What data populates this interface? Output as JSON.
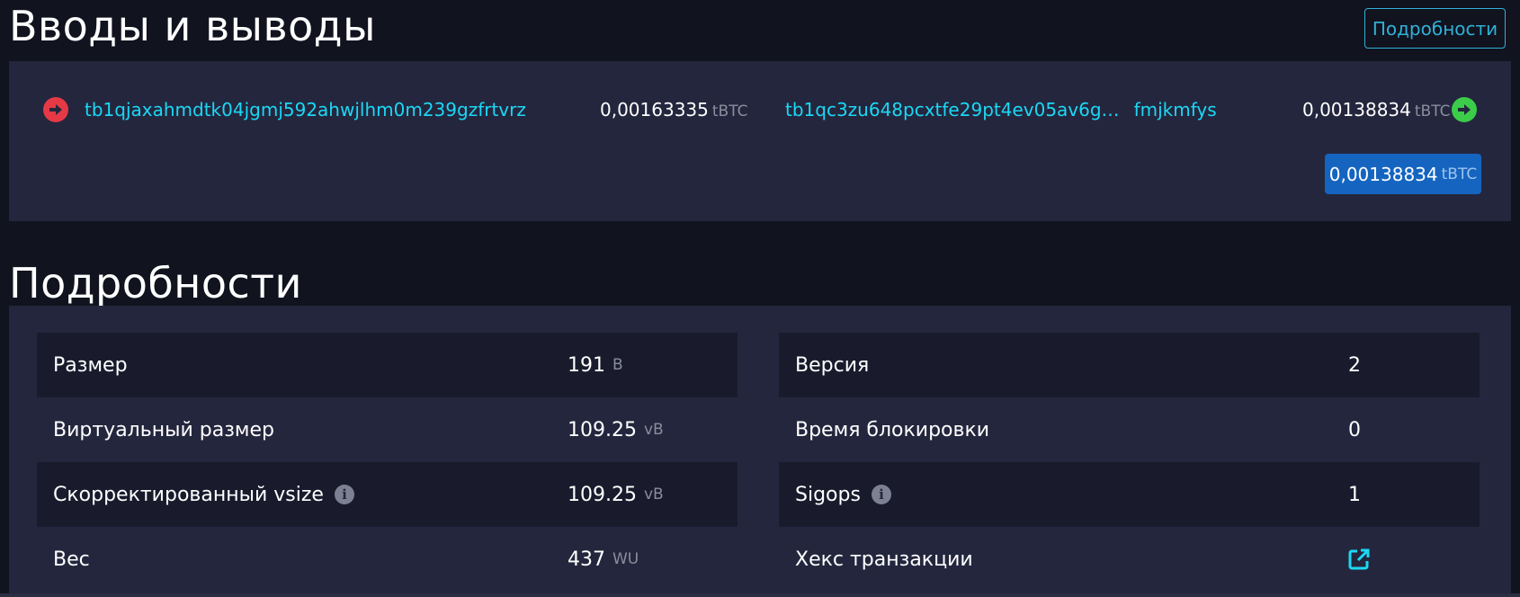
{
  "io_section": {
    "title": "Вводы и выводы",
    "details_button": "Подробности",
    "input": {
      "address": "tb1qjaxahmdtk04jgmj592ahwjlhm0m239gzfrtvrz",
      "amount": "0,00163335",
      "unit": "tBTC",
      "icon": "arrow-right-circle-icon",
      "icon_color": "#e53946"
    },
    "output": {
      "address_start": "tb1qc3zu648pcxtfe29pt4ev05av6g…",
      "address_end": "fmjkmfys",
      "amount": "0,00138834",
      "unit": "tBTC",
      "icon": "arrow-right-circle-icon",
      "icon_color": "#3bcc49"
    },
    "total": {
      "amount": "0,00138834",
      "unit": "tBTC"
    }
  },
  "details_section": {
    "title": "Подробности",
    "left": [
      {
        "label": "Размер",
        "value": "191",
        "unit": "B"
      },
      {
        "label": "Виртуальный размер",
        "value": "109.25",
        "unit": "vB"
      },
      {
        "label": "Скорректированный vsize",
        "value": "109.25",
        "unit": "vB",
        "info": "i"
      },
      {
        "label": "Вес",
        "value": "437",
        "unit": "WU"
      }
    ],
    "right": [
      {
        "label": "Версия",
        "value": "2"
      },
      {
        "label": "Время блокировки",
        "value": "0"
      },
      {
        "label": "Sigops",
        "value": "1",
        "info": "i"
      },
      {
        "label": "Хекс транзакции",
        "icon": "external-link-icon"
      }
    ]
  },
  "colors": {
    "background": "#11131f",
    "panel": "#24263e",
    "row_dark": "#191b2d",
    "link": "#1bd8f4",
    "accent_blue": "#1565c0"
  }
}
